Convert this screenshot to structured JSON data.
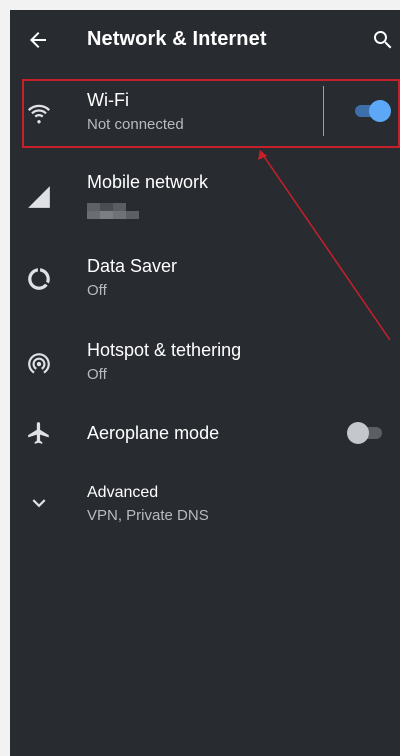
{
  "header": {
    "title": "Network & Internet",
    "back_icon": "arrow-back-icon",
    "search_icon": "search-icon"
  },
  "settings": {
    "wifi": {
      "label": "Wi-Fi",
      "status": "Not connected",
      "icon": "wifi-icon",
      "toggle_on": true
    },
    "mobile_network": {
      "label": "Mobile network",
      "icon": "signal-icon"
    },
    "data_saver": {
      "label": "Data Saver",
      "status": "Off",
      "icon": "data-saver-icon"
    },
    "hotspot": {
      "label": "Hotspot & tethering",
      "status": "Off",
      "icon": "hotspot-icon"
    },
    "aeroplane": {
      "label": "Aeroplane mode",
      "icon": "airplane-icon",
      "toggle_on": false
    },
    "advanced": {
      "label": "Advanced",
      "status": "VPN, Private DNS",
      "icon": "chevron-down-icon"
    }
  },
  "colors": {
    "background": "#282b30",
    "accent": "#5ca8f7",
    "annotation": "#c8202a"
  }
}
